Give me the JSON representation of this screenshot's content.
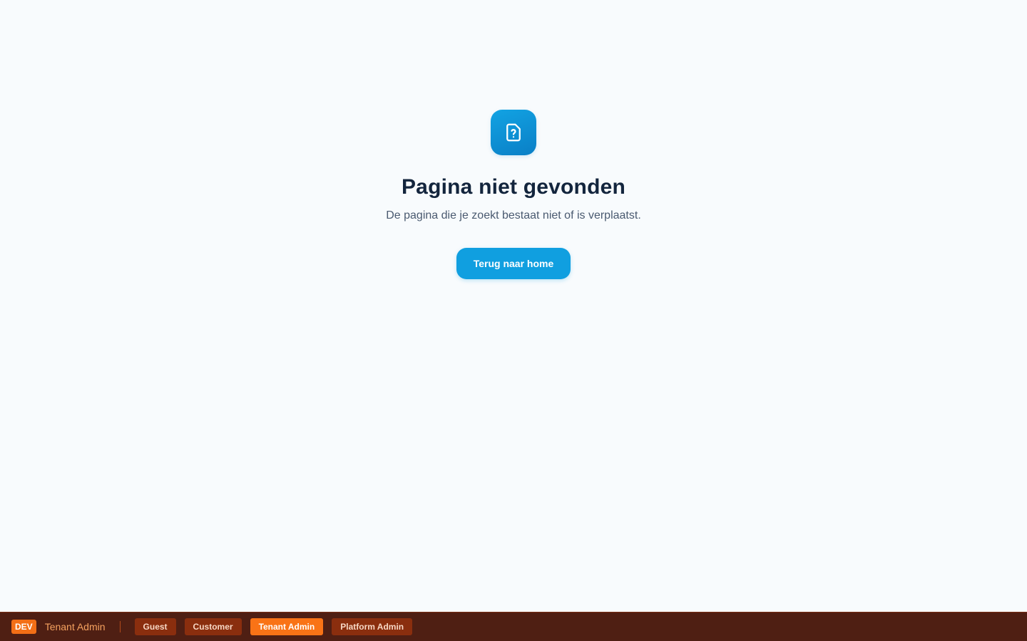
{
  "not_found": {
    "icon": "file-question-icon",
    "title": "Pagina niet gevonden",
    "message": "De pagina die je zoekt bestaat niet of is verplaatst.",
    "home_button_label": "Terug naar home"
  },
  "dev_toolbar": {
    "badge": "DEV",
    "current_role": "Tenant Admin",
    "roles": [
      {
        "label": "Guest",
        "active": false
      },
      {
        "label": "Customer",
        "active": false
      },
      {
        "label": "Tenant Admin",
        "active": true
      },
      {
        "label": "Platform Admin",
        "active": false
      }
    ]
  },
  "colors": {
    "background": "#f8fbfd",
    "accent": "#109fe0",
    "heading": "#13253d",
    "devbar": "#4f1f13",
    "devbar_active": "#f97316"
  }
}
